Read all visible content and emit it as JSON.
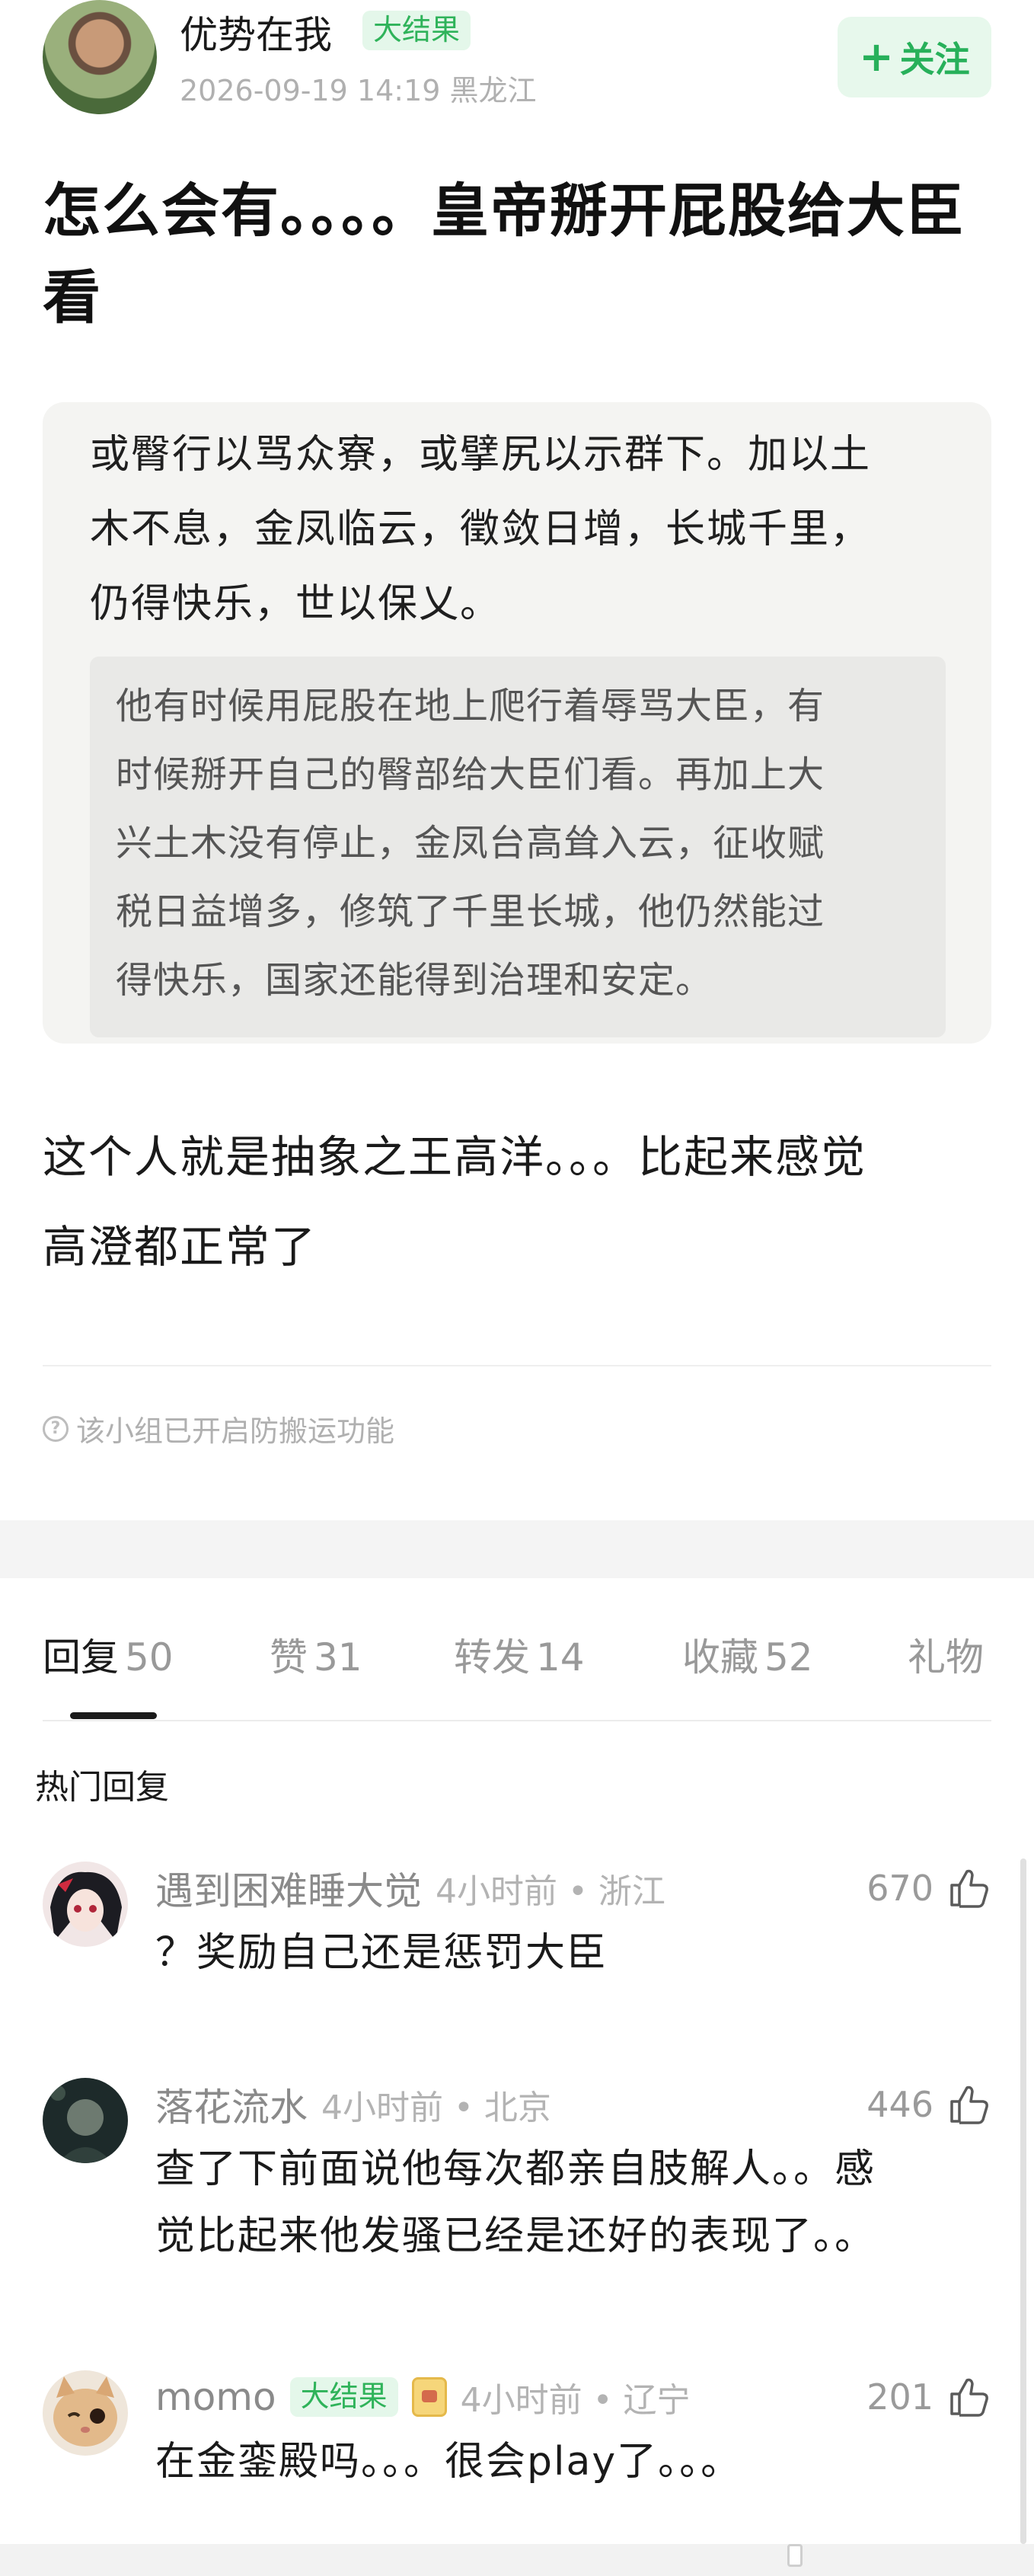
{
  "author": {
    "name": "优势在我",
    "badge": "大结果",
    "meta": "2026-09-19 14:19  黑龙江",
    "follow_plus": "+",
    "follow_label": "关注"
  },
  "post": {
    "title": "怎么会有。。。。皇帝掰开屁股给大臣看",
    "quote_lines": [
      "或臀行以骂众寮，或擘尻以示群下。加以土",
      "木不息，金凤临云，徵敛日增，长城千里，",
      "仍得快乐，世以保乂。"
    ],
    "translation_lines": [
      "他有时候用屁股在地上爬行着辱骂大臣，有",
      "时候掰开自己的臀部给大臣们看。再加上大",
      "兴土木没有停止，金凤台高耸入云，征收赋",
      "税日益增多，修筑了千里长城，他仍然能过",
      "得快乐，国家还能得到治理和安定。"
    ],
    "body_lines": [
      "这个人就是抽象之王高洋。。。比起来感觉",
      "高澄都正常了"
    ],
    "notice": "该小组已开启防搬运功能",
    "notice_icon": "?"
  },
  "tabs": [
    {
      "label": "回复",
      "count": "50"
    },
    {
      "label": "赞",
      "count": "31"
    },
    {
      "label": "转发",
      "count": "14"
    },
    {
      "label": "收藏",
      "count": "52"
    },
    {
      "label": "礼物",
      "count": ""
    }
  ],
  "hot_heading": "热门回复",
  "comments": [
    {
      "user": "遇到困难睡大觉",
      "meta": "4小时前 • 浙江",
      "likes": "670",
      "lines": [
        "？奖励自己还是惩罚大臣"
      ]
    },
    {
      "user": "落花流水",
      "meta": "4小时前 • 北京",
      "likes": "446",
      "lines": [
        "查了下前面说他每次都亲自肢解人。。感",
        "觉比起来他发骚已经是还好的表现了。。"
      ]
    },
    {
      "user": "momo",
      "badge": "大结果",
      "meta": "4小时前 • 辽宁",
      "likes": "201",
      "lines": [
        "在金銮殿吗。。。很会play了。。。"
      ]
    }
  ],
  "colors": {
    "accent_green": "#27b05a",
    "badge_bg": "#e4f7ea",
    "muted_text": "#b0b0b0"
  },
  "icons": [
    "thumbs-up-icon",
    "help-circle-icon",
    "plus-icon"
  ]
}
